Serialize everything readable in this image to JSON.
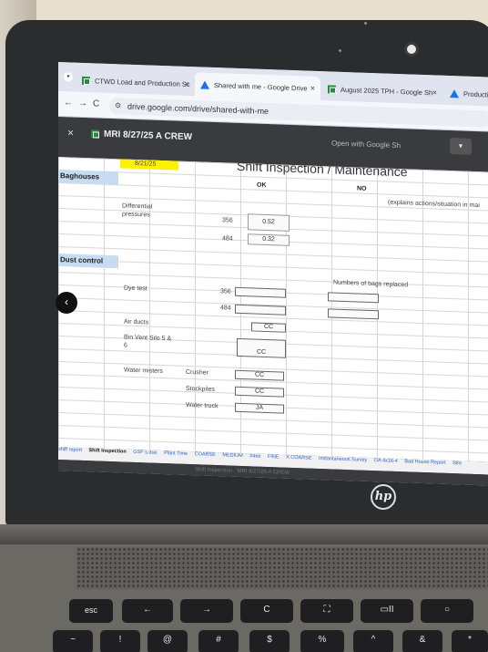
{
  "browser": {
    "tabs": [
      {
        "label": "CTWD Load and Production Sc",
        "icon": "sheets-icon",
        "active": false
      },
      {
        "label": "Shared with me - Google Drive",
        "icon": "drive-icon",
        "active": true
      },
      {
        "label": "August 2025 TPH - Google Sh",
        "icon": "sheets-icon",
        "active": false
      },
      {
        "label": "Producti",
        "icon": "drive-icon",
        "active": false
      }
    ],
    "close_glyph": "×",
    "url": "drive.google.com/drive/shared-with-me",
    "nav": {
      "back": "←",
      "forward": "→",
      "reload": "C"
    }
  },
  "viewer": {
    "close_glyph": "×",
    "file_title": "MRI 8/27/25 A CREW",
    "open_with": "Open with Google Sh",
    "more_glyph": "▾",
    "prev_glyph": "‹"
  },
  "sheet": {
    "date": "8/21/25",
    "title": "Shift Inspection / Maintenance",
    "col_ok": "OK",
    "col_no": "NO",
    "col_explain": "(explains actions/situation in mai",
    "baghouses": {
      "section": "Baghouses",
      "label_line1": "Differential",
      "label_line2": "pressures",
      "rows": [
        {
          "unit": "356",
          "value": "0.52"
        },
        {
          "unit": "484",
          "value": "0.32"
        }
      ]
    },
    "dust": {
      "section": "Dust control",
      "bags_label": "Numbers of bags replaced",
      "dye_test": "Dye test",
      "dye_units": [
        "356",
        "484"
      ],
      "air_ducts": "Air ducts",
      "air_ducts_value": "CC",
      "bin_vent_line1": "Bin Vent Silo 5 &",
      "bin_vent_line2": "6",
      "bin_vent_value": "CC",
      "water_misters": "Water misters",
      "misters": [
        {
          "name": "Crusher",
          "value": "CC"
        },
        {
          "name": "Stockpiles",
          "value": "CC"
        },
        {
          "name": "Water truck",
          "value": "JA"
        }
      ]
    },
    "sheet_tabs": [
      "shift report",
      "Shift Inspection",
      "GSF s.due",
      "Plant Time",
      "COARSE",
      "MEDIUM",
      "#4ee",
      "FINE",
      "X COARSE",
      "Instantaneous Survey",
      "OA 4x16-4",
      "Bad House Report",
      "Stre"
    ],
    "active_sheet_tab": "Shift Inspection",
    "footer_ghost": "Shift Inspection  ·  MRI 8/27/25 A CREW"
  },
  "laptop": {
    "logo": "hp",
    "keys": {
      "esc": "esc",
      "back": "←",
      "forward": "→",
      "reload": "C",
      "fullscreen": "⛶",
      "overview": "▭II",
      "dim": "○",
      "row2": [
        "~",
        "!",
        "@",
        "#",
        "$",
        "%",
        "^",
        "&",
        "*"
      ]
    }
  }
}
